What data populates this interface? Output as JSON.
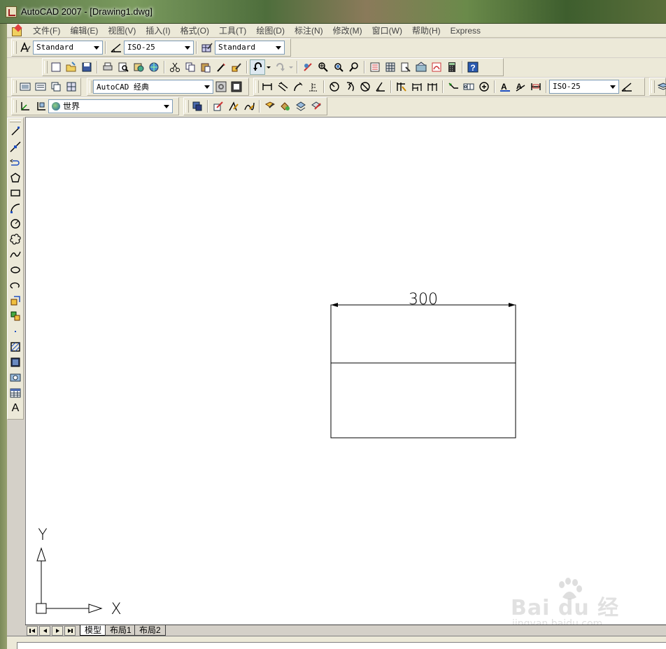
{
  "window": {
    "title": "AutoCAD 2007 - [Drawing1.dwg]",
    "icon": "autocad-app-icon"
  },
  "menu": {
    "items": [
      "文件(F)",
      "编辑(E)",
      "视图(V)",
      "插入(I)",
      "格式(O)",
      "工具(T)",
      "绘图(D)",
      "标注(N)",
      "修改(M)",
      "窗口(W)",
      "帮助(H)",
      "Express"
    ]
  },
  "styles_toolbar": {
    "text_style": "Standard",
    "dim_style": "ISO-25",
    "table_style": "Standard"
  },
  "workspace_toolbar": {
    "workspace": "AutoCAD 经典"
  },
  "dimension_toolbar": {
    "dim_style": "ISO-25"
  },
  "ucs_toolbar": {
    "ucs": "世界"
  },
  "drawing": {
    "dimension_text": "300",
    "ucs_x_label": "X",
    "ucs_y_label": "Y"
  },
  "layout_tabs": {
    "items": [
      "模型",
      "布局1",
      "布局2"
    ],
    "active": "模型"
  },
  "watermark": {
    "logo": "Bai du 经验",
    "url": "jingyan.baidu.com"
  },
  "colors": {
    "canvas": "#ffffff",
    "toolbar": "#ece9d8",
    "menu_text": "#444444"
  }
}
